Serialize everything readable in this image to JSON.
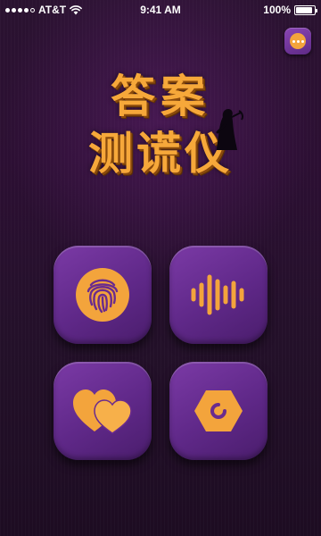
{
  "status_bar": {
    "carrier": "AT&T",
    "time": "9:41 AM",
    "battery": "100%",
    "signal_bars": 4
  },
  "header": {
    "more_icon": "more-dots-icon"
  },
  "title": {
    "line1": "答案",
    "line2": "测谎仪"
  },
  "tiles": [
    {
      "icon": "fingerprint-icon"
    },
    {
      "icon": "voice-wave-icon"
    },
    {
      "icon": "hearts-icon"
    },
    {
      "icon": "hexagon-refresh-icon"
    }
  ],
  "colors": {
    "accent_orange": "#f6a83a",
    "tile_purple": "#6a2e95",
    "background": "#261130"
  }
}
